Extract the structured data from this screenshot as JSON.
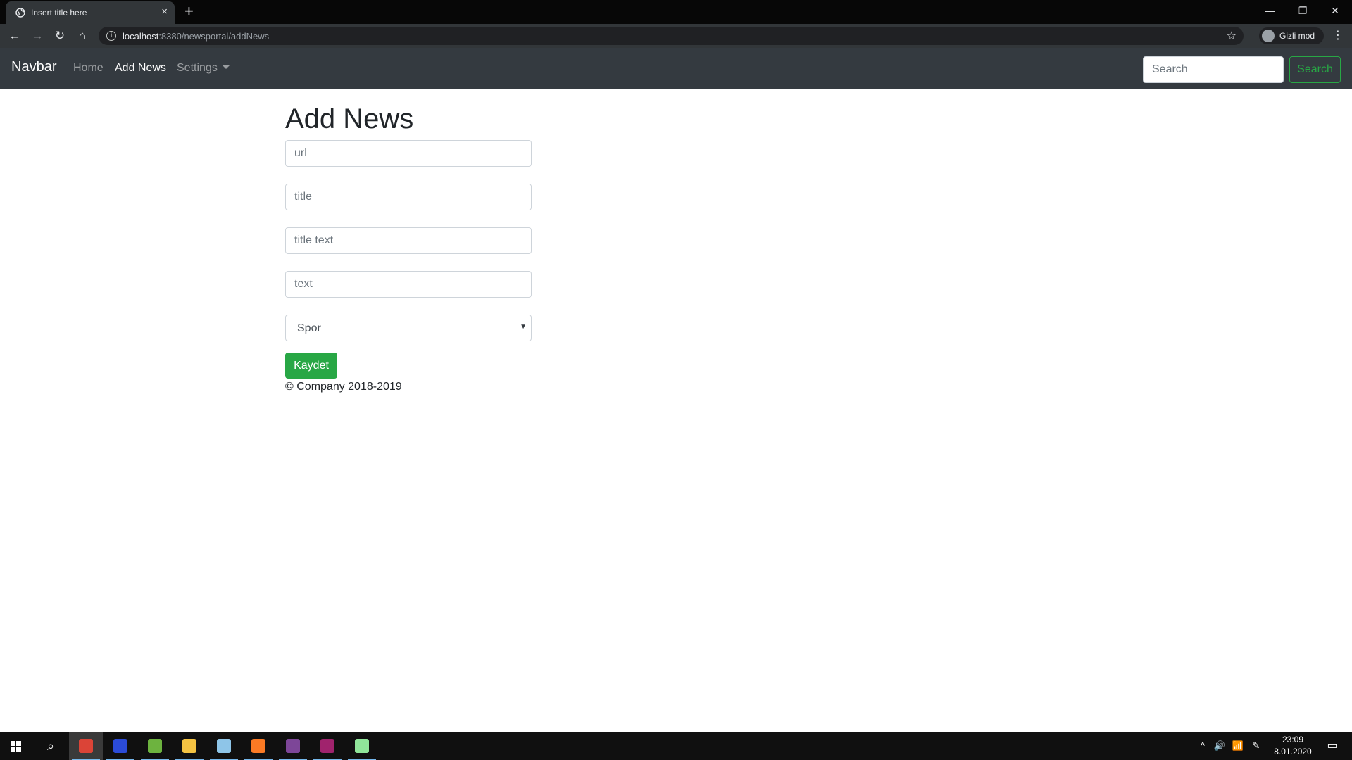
{
  "browser": {
    "tab_title": "Insert title here",
    "tab_close": "×",
    "new_tab": "+",
    "url_host": "localhost",
    "url_rest": ":8380/newsportal/addNews",
    "incognito_label": "Gizli mod",
    "back": "←",
    "forward": "→",
    "reload": "↻",
    "home": "⌂",
    "star": "☆",
    "menu": "⋮",
    "info": "i",
    "minimize": "—",
    "restore": "❐",
    "close": "✕"
  },
  "navbar": {
    "brand": "Navbar",
    "links": [
      {
        "label": "Home",
        "active": false
      },
      {
        "label": "Add News",
        "active": true
      },
      {
        "label": "Settings",
        "active": false,
        "dropdown": true
      }
    ],
    "search_placeholder": "Search",
    "search_button": "Search"
  },
  "page": {
    "title": "Add News",
    "fields": [
      {
        "placeholder": "url"
      },
      {
        "placeholder": "title"
      },
      {
        "placeholder": "title text"
      },
      {
        "placeholder": "text"
      }
    ],
    "category_selected": "Spor",
    "select_arrow": "▼",
    "save_button": "Kaydet",
    "footer": "© Company 2018-2019"
  },
  "taskbar": {
    "search_icon": "⌕",
    "apps": [
      {
        "icon": "chrome-icon",
        "color": "#db4437",
        "active": true
      },
      {
        "icon": "intellij-icon",
        "color": "#2b4bd8",
        "active": false
      },
      {
        "icon": "spring-icon",
        "color": "#6db33f",
        "active": false
      },
      {
        "icon": "file-explorer-icon",
        "color": "#f5c342",
        "active": false
      },
      {
        "icon": "notepad-icon",
        "color": "#8ec5e8",
        "active": false
      },
      {
        "icon": "xampp-icon",
        "color": "#fb7a24",
        "active": false
      },
      {
        "icon": "tor-icon",
        "color": "#7d4698",
        "active": false
      },
      {
        "icon": "winrar-icon",
        "color": "#a0236d",
        "active": false
      },
      {
        "icon": "notepad-plus-plus-icon",
        "color": "#90e59a",
        "active": false
      }
    ],
    "tray_chevron": "^",
    "tray_volume": "🔊",
    "tray_network": "📶",
    "tray_pen": "✎",
    "time": "23:09",
    "date": "8.01.2020",
    "notification": "▭"
  }
}
